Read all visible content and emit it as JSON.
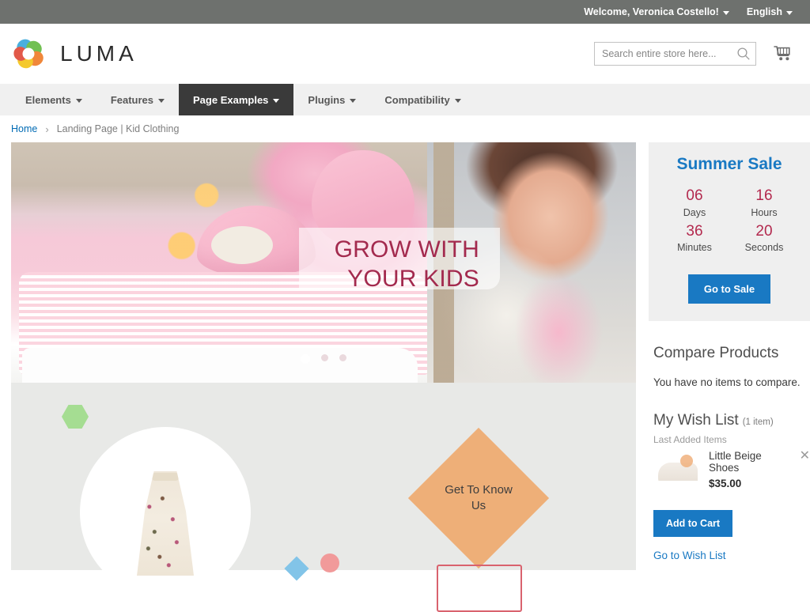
{
  "top_panel": {
    "welcome": "Welcome, Veronica Costello!",
    "language": "English",
    "caret_icon": "chevron-down-icon"
  },
  "header": {
    "logo_text": "LUMA",
    "logo_icon": "luma-flower-logo",
    "search": {
      "placeholder": "Search entire store here...",
      "value": "",
      "icon": "search-icon"
    },
    "cart_icon": "shopping-cart-icon"
  },
  "nav": {
    "items": [
      {
        "label": "Elements",
        "active": false,
        "caret": "chevron-down-icon"
      },
      {
        "label": "Features",
        "active": false,
        "caret": "chevron-down-icon"
      },
      {
        "label": "Page Examples",
        "active": true,
        "caret": "chevron-down-icon"
      },
      {
        "label": "Plugins",
        "active": false,
        "caret": "chevron-down-icon"
      },
      {
        "label": "Compatibility",
        "active": false,
        "caret": "chevron-down-icon"
      }
    ]
  },
  "breadcrumbs": {
    "home": "Home",
    "separator": "›",
    "current": "Landing Page | Kid Clothing"
  },
  "hero": {
    "caption_line1": "GROW WITH",
    "caption_line2": "YOUR KIDS",
    "caption_color": "#a32a4e",
    "slides": 3,
    "active_slide": 1
  },
  "promo": {
    "cta_line1": "Get To Know",
    "cta_line2": "Us",
    "cta_color": "#eeaf78",
    "hexagon_color": "#a5dd92",
    "blue_diamond_color": "#82c4e8",
    "pink_circle_color": "#f19a9a",
    "outline_box_color": "#d9626e",
    "background": "#e8e9e7"
  },
  "sidebar": {
    "sale": {
      "title": "Summer Sale",
      "title_color": "#1979c3",
      "number_color": "#b3294e",
      "days_value": "06",
      "days_label": "Days",
      "hours_value": "16",
      "hours_label": "Hours",
      "minutes_value": "36",
      "minutes_label": "Minutes",
      "seconds_value": "20",
      "seconds_label": "Seconds",
      "button_label": "Go to Sale"
    },
    "compare": {
      "title": "Compare Products",
      "empty_text": "You have no items to compare."
    },
    "wishlist": {
      "title": "My Wish List",
      "count": "(1 item)",
      "last_added_label": "Last Added Items",
      "item_name": "Little Beige Shoes",
      "item_price": "$35.00",
      "item_thumb_icon": "beige-shoe-thumbnail",
      "remove_icon": "close-icon",
      "add_to_cart_label": "Add to Cart",
      "go_to_wishlist_label": "Go to Wish List"
    }
  }
}
